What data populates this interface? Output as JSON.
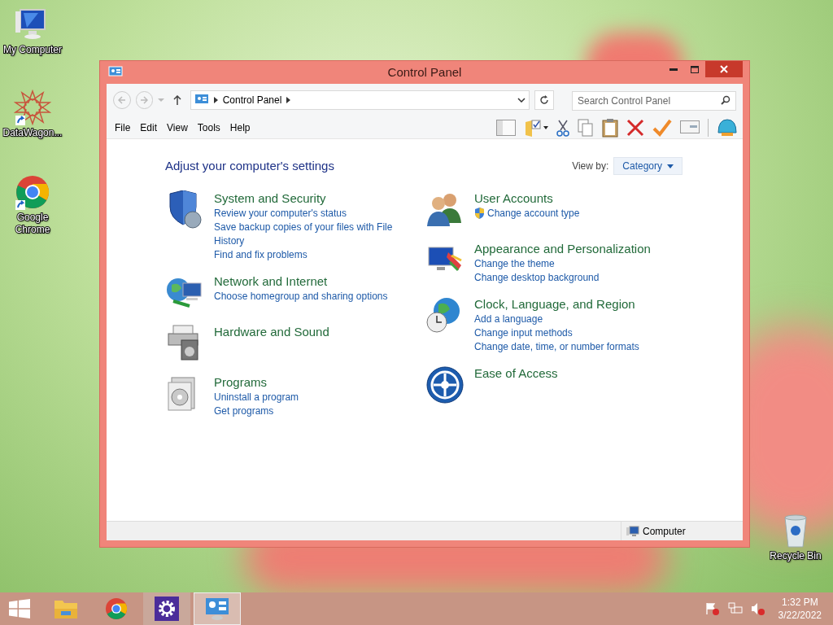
{
  "desktop_icons": [
    {
      "kind": "computer",
      "label": "My Computer",
      "shortcut": false
    },
    {
      "kind": "star",
      "label": "DataWagon...",
      "shortcut": true
    },
    {
      "kind": "chrome",
      "label": "Google Chrome",
      "shortcut": true
    },
    {
      "kind": "recycle",
      "label": "Recycle Bin",
      "shortcut": false
    }
  ],
  "window": {
    "title": "Control Panel",
    "address": {
      "crumb": "Control Panel"
    },
    "search": {
      "placeholder": "Search Control Panel"
    },
    "menu": [
      "File",
      "Edit",
      "View",
      "Tools",
      "Help"
    ],
    "heading": "Adjust your computer's settings",
    "view_by": {
      "label": "View by:",
      "value": "Category"
    },
    "columns": [
      [
        {
          "kind": "security",
          "title": "System and Security",
          "links": [
            {
              "text": "Review your computer's status",
              "shield": false
            },
            {
              "text": "Save backup copies of your files with File History",
              "shield": false
            },
            {
              "text": "Find and fix problems",
              "shield": false
            }
          ]
        },
        {
          "kind": "network",
          "title": "Network and Internet",
          "links": [
            {
              "text": "Choose homegroup and sharing options",
              "shield": false
            }
          ]
        },
        {
          "kind": "hardware",
          "title": "Hardware and Sound"
        },
        {
          "kind": "programs",
          "title": "Programs",
          "links": [
            {
              "text": "Uninstall a program",
              "shield": false
            },
            {
              "text": "Get programs",
              "shield": false
            }
          ]
        }
      ],
      [
        {
          "kind": "users",
          "title": "User Accounts",
          "links": [
            {
              "text": "Change account type",
              "shield": true
            }
          ]
        },
        {
          "kind": "appearance",
          "title": "Appearance and Personalization",
          "links": [
            {
              "text": "Change the theme",
              "shield": false
            },
            {
              "text": "Change desktop background",
              "shield": false
            }
          ]
        },
        {
          "kind": "clock",
          "title": "Clock, Language, and Region",
          "links": [
            {
              "text": "Add a language",
              "shield": false
            },
            {
              "text": "Change input methods",
              "shield": false
            },
            {
              "text": "Change date, time, or number formats",
              "shield": false
            }
          ]
        },
        {
          "kind": "access",
          "title": "Ease of Access"
        }
      ]
    ],
    "status_bar": "Computer"
  },
  "taskbar": {
    "items": [
      {
        "kind": "explorer",
        "running": false,
        "selected": false
      },
      {
        "kind": "chrome",
        "running": false,
        "selected": false
      },
      {
        "kind": "settings",
        "running": true,
        "selected": false
      },
      {
        "kind": "controlpanel",
        "running": true,
        "selected": true
      }
    ],
    "time": "1:32 PM",
    "date": "3/22/2022"
  }
}
